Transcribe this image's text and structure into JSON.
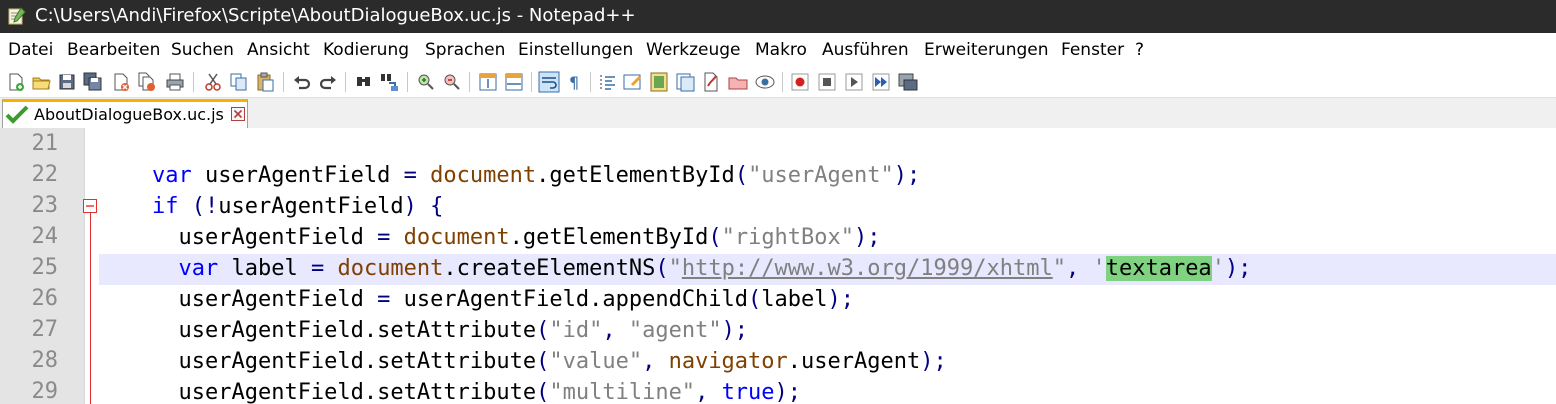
{
  "window": {
    "title": "C:\\Users\\Andi\\Firefox\\Scripte\\AboutDialogueBox.uc.js - Notepad++"
  },
  "menu": {
    "items": [
      "Datei",
      "Bearbeiten",
      "Suchen",
      "Ansicht",
      "Kodierung",
      "Sprachen",
      "Einstellungen",
      "Werkzeuge",
      "Makro",
      "Ausführen",
      "Erweiterungen",
      "Fenster",
      "?"
    ]
  },
  "tab": {
    "label": "AboutDialogueBox.uc.js"
  },
  "editor": {
    "line_numbers": [
      "21",
      "22",
      "23",
      "24",
      "25",
      "26",
      "27",
      "28",
      "29"
    ],
    "lines": [
      [],
      [
        [
          "    ",
          "p"
        ],
        [
          "var",
          "kw"
        ],
        [
          " userAgentField ",
          "p"
        ],
        [
          "=",
          "op"
        ],
        [
          " ",
          "p"
        ],
        [
          "document",
          "obj"
        ],
        [
          ".getElementById",
          "p"
        ],
        [
          "(",
          "op"
        ],
        [
          "\"userAgent\"",
          "str"
        ],
        [
          ");",
          "op"
        ]
      ],
      [
        [
          "    ",
          "p"
        ],
        [
          "if",
          "kw"
        ],
        [
          " ",
          "p"
        ],
        [
          "(!",
          "op"
        ],
        [
          "userAgentField",
          "p"
        ],
        [
          ")",
          "op"
        ],
        [
          " ",
          "p"
        ],
        [
          "{",
          "op"
        ]
      ],
      [
        [
          "      ",
          "p"
        ],
        [
          "userAgentField ",
          "p"
        ],
        [
          "=",
          "op"
        ],
        [
          " ",
          "p"
        ],
        [
          "document",
          "obj"
        ],
        [
          ".getElementById",
          "p"
        ],
        [
          "(",
          "op"
        ],
        [
          "\"rightBox\"",
          "str"
        ],
        [
          ");",
          "op"
        ]
      ],
      [
        [
          "      ",
          "p"
        ],
        [
          "var",
          "kw"
        ],
        [
          " label ",
          "p"
        ],
        [
          "=",
          "op"
        ],
        [
          " ",
          "p"
        ],
        [
          "document",
          "obj"
        ],
        [
          ".createElementNS",
          "p"
        ],
        [
          "(",
          "op"
        ],
        [
          "\"",
          "str"
        ],
        [
          "http://www.w3.org/1999/xhtml",
          "url"
        ],
        [
          "\"",
          "str"
        ],
        [
          ", ",
          "op"
        ],
        [
          "'",
          "str"
        ],
        [
          "textarea",
          "hl"
        ],
        [
          "'",
          "str"
        ],
        [
          ");",
          "op"
        ]
      ],
      [
        [
          "      ",
          "p"
        ],
        [
          "userAgentField ",
          "p"
        ],
        [
          "=",
          "op"
        ],
        [
          " userAgentField.appendChild",
          "p"
        ],
        [
          "(",
          "op"
        ],
        [
          "label",
          "p"
        ],
        [
          ");",
          "op"
        ]
      ],
      [
        [
          "      ",
          "p"
        ],
        [
          "userAgentField.setAttribute",
          "p"
        ],
        [
          "(",
          "op"
        ],
        [
          "\"id\"",
          "str"
        ],
        [
          ", ",
          "op"
        ],
        [
          "\"agent\"",
          "str"
        ],
        [
          ");",
          "op"
        ]
      ],
      [
        [
          "      ",
          "p"
        ],
        [
          "userAgentField.setAttribute",
          "p"
        ],
        [
          "(",
          "op"
        ],
        [
          "\"value\"",
          "str"
        ],
        [
          ", ",
          "op"
        ],
        [
          "navigator",
          "obj"
        ],
        [
          ".userAgent",
          "p"
        ],
        [
          ");",
          "op"
        ]
      ],
      [
        [
          "      ",
          "p"
        ],
        [
          "userAgentField.setAttribute",
          "p"
        ],
        [
          "(",
          "op"
        ],
        [
          "\"multiline\"",
          "str"
        ],
        [
          ", ",
          "op"
        ],
        [
          "true",
          "kw"
        ],
        [
          ");",
          "op"
        ]
      ]
    ],
    "current_line": "25"
  },
  "colors": {
    "keyword": "#0000ff",
    "object": "#804000",
    "string": "#808080",
    "match_highlight": "#7fd280",
    "current_line": "#e8e8ff",
    "tab_accent": "#fab000"
  },
  "icons": {
    "toolbar": [
      "new-file-icon",
      "open-file-icon",
      "save-icon",
      "save-all-icon",
      "close-icon",
      "close-all-icon",
      "print-icon",
      "cut-icon",
      "copy-icon",
      "paste-icon",
      "undo-icon",
      "redo-icon",
      "find-icon",
      "replace-icon",
      "zoom-in-icon",
      "zoom-out-icon",
      "sync-vertical-icon",
      "sync-horizontal-icon",
      "word-wrap-icon",
      "show-all-chars-icon",
      "indent-guide-icon",
      "user-language-icon",
      "document-map-icon",
      "function-list-icon",
      "folder-workspace-icon",
      "document-list-icon",
      "monitoring-icon",
      "record-macro-icon",
      "stop-macro-icon",
      "play-macro-icon",
      "run-macro-multiple-icon",
      "save-macro-icon"
    ]
  }
}
